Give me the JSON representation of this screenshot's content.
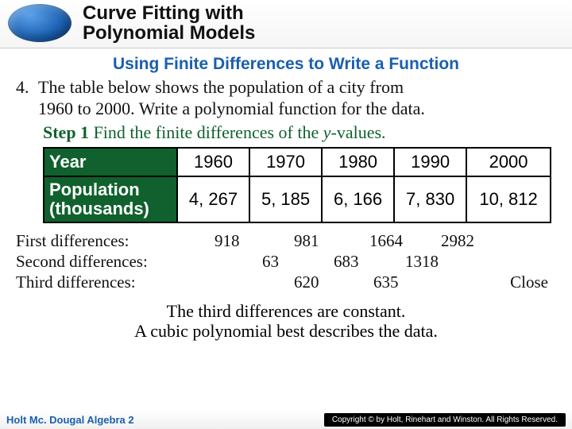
{
  "header": {
    "title_line1": "Curve Fitting with",
    "title_line2": "Polynomial Models"
  },
  "subtitle": "Using Finite Differences to Write a Function",
  "problem": {
    "number": "4.",
    "text_line1": "The table below shows the population of a city from",
    "text_line2": "1960 to 2000. Write a polynomial function for the data."
  },
  "step1": {
    "label": "Step 1",
    "rest": "  Find the finite differences of the ",
    "yvar": "y",
    "rest2": "-values."
  },
  "table": {
    "row1_label": "Year",
    "years": [
      "1960",
      "1970",
      "1980",
      "1990",
      "2000"
    ],
    "row2_label_l1": "Population",
    "row2_label_l2": "(thousands)",
    "pops": [
      "4, 267",
      "5, 185",
      "6, 166",
      "7, 830",
      "10, 812"
    ]
  },
  "diffs": {
    "label1": "First differences:",
    "label2": "Second differences:",
    "label3": "Third differences:",
    "first": [
      "918",
      "981",
      "1664",
      "2982"
    ],
    "second": [
      "63",
      "683",
      "1318"
    ],
    "third": [
      "620",
      "635"
    ],
    "close": "Close"
  },
  "conclusion": {
    "l1": "The third differences are constant.",
    "l2": "A cubic polynomial best describes the data."
  },
  "footer": {
    "left": "Holt Mc. Dougal Algebra 2",
    "right": "Copyright © by Holt, Rinehart and Winston. All Rights Reserved."
  },
  "chart_data": {
    "type": "table",
    "title": "Population of a city 1960–2000",
    "categories": [
      1960,
      1970,
      1980,
      1990,
      2000
    ],
    "series": [
      {
        "name": "Population (thousands)",
        "values": [
          4267,
          5185,
          6166,
          7830,
          10812
        ]
      }
    ],
    "first_differences": [
      918,
      981,
      1664,
      2982
    ],
    "second_differences": [
      63,
      683,
      1318
    ],
    "third_differences": [
      620,
      635
    ]
  }
}
